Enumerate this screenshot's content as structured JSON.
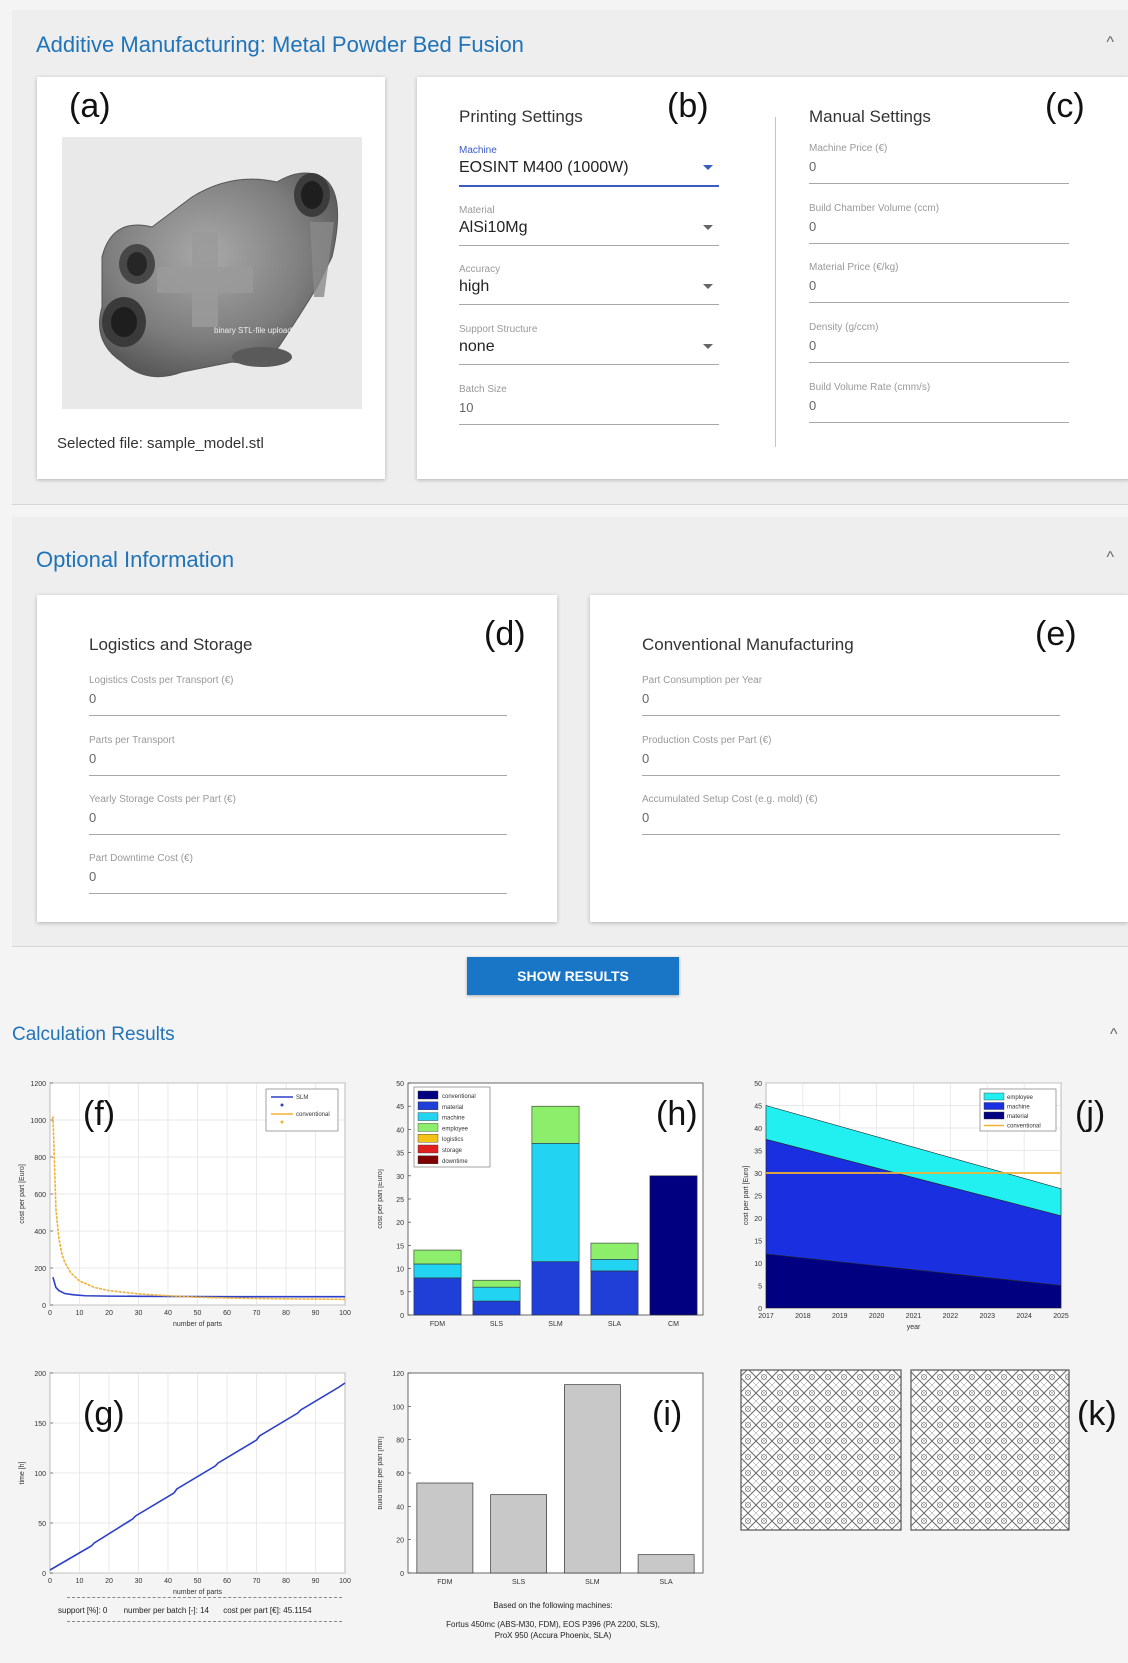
{
  "am_section": {
    "title": "Additive Manufacturing: Metal Powder Bed Fusion",
    "upload": {
      "letter": "(a)",
      "overlay_text": "binary STL-file upload",
      "selected_file": "Selected file: sample_model.stl"
    },
    "printing": {
      "letter": "(b)",
      "heading": "Printing Settings",
      "fields": [
        {
          "label": "Machine",
          "value": "EOSINT M400 (1000W)"
        },
        {
          "label": "Material",
          "value": "AlSi10Mg"
        },
        {
          "label": "Accuracy",
          "value": "high"
        },
        {
          "label": "Support Structure",
          "value": "none"
        },
        {
          "label": "Batch Size",
          "value": "10"
        }
      ]
    },
    "manual": {
      "letter": "(c)",
      "heading": "Manual Settings",
      "fields": [
        {
          "label": "Machine Price (€)",
          "value": "0"
        },
        {
          "label": "Build Chamber Volume (ccm)",
          "value": "0"
        },
        {
          "label": "Material Price (€/kg)",
          "value": "0"
        },
        {
          "label": "Density (g/ccm)",
          "value": "0"
        },
        {
          "label": "Build Volume Rate (cmm/s)",
          "value": "0"
        }
      ]
    }
  },
  "optional_section": {
    "title": "Optional Information",
    "logistics": {
      "letter": "(d)",
      "heading": "Logistics and Storage",
      "fields": [
        {
          "label": "Logistics Costs per Transport (€)",
          "value": "0"
        },
        {
          "label": "Parts per Transport",
          "value": "0"
        },
        {
          "label": "Yearly Storage Costs per Part (€)",
          "value": "0"
        },
        {
          "label": "Part Downtime Cost (€)",
          "value": "0"
        }
      ]
    },
    "conventional": {
      "letter": "(e)",
      "heading": "Conventional Manufacturing",
      "fields": [
        {
          "label": "Part Consumption per Year",
          "value": "0"
        },
        {
          "label": "Production Costs per Part (€)",
          "value": "0"
        },
        {
          "label": "Accumulated Setup Cost (e.g. mold) (€)",
          "value": "0"
        }
      ]
    }
  },
  "show_results_label": "SHOW RESULTS",
  "results_section": {
    "title": "Calculation Results",
    "letters": {
      "f": "(f)",
      "g": "(g)",
      "h": "(h)",
      "i": "(i)",
      "j": "(j)",
      "k": "(k)"
    },
    "f_summary": {
      "support": "support [%]: 0",
      "batch": "number per batch [-]: 14",
      "cost": "cost per part [€]: 45.1154"
    },
    "i_caption": [
      "Based on the following machines:",
      "Fortus 450mc (ABS-M30, FDM), EOS P396 (PA 2200, SLS),",
      "ProX 950 (Accura Phoenix, SLA)"
    ]
  },
  "colors": {
    "accent": "#1976c6",
    "title_blue": "#1f73b8",
    "slm_line": "#2b3fc9",
    "conventional_line": "#f2b233",
    "bar_gray": "#c8c8c8"
  },
  "chart_data": [
    {
      "id": "f",
      "type": "line",
      "xlabel": "number of parts",
      "ylabel": "cost per part [Euro]",
      "xlim": [
        0,
        100
      ],
      "ylim": [
        0,
        1200
      ],
      "xticks": [
        0,
        10,
        20,
        30,
        40,
        50,
        60,
        70,
        80,
        90,
        100
      ],
      "yticks": [
        0,
        200,
        400,
        600,
        800,
        1000,
        1200
      ],
      "legend": [
        "SLM",
        "conventional"
      ],
      "legend_position": "top-right",
      "grid": true,
      "series": [
        {
          "name": "SLM",
          "x": [
            1,
            2,
            3,
            5,
            8,
            12,
            20,
            30,
            40,
            50,
            60,
            70,
            80,
            90,
            100
          ],
          "y": [
            150,
            95,
            78,
            62,
            55,
            50,
            48,
            47,
            46,
            46,
            45,
            45,
            45,
            45,
            45
          ]
        },
        {
          "name": "conventional",
          "x": [
            1,
            2,
            3,
            4,
            5,
            7,
            10,
            15,
            20,
            30,
            40,
            50,
            60,
            70,
            80,
            90,
            100
          ],
          "y": [
            1020,
            520,
            360,
            280,
            230,
            175,
            130,
            95,
            78,
            60,
            50,
            42,
            38,
            35,
            33,
            32,
            30
          ]
        }
      ]
    },
    {
      "id": "g",
      "type": "line",
      "xlabel": "number of parts",
      "ylabel": "time [h]",
      "xlim": [
        0,
        100
      ],
      "ylim": [
        0,
        200
      ],
      "xticks": [
        0,
        10,
        20,
        30,
        40,
        50,
        60,
        70,
        80,
        90,
        100
      ],
      "yticks": [
        0,
        50,
        100,
        150,
        200
      ],
      "grid": true,
      "series": [
        {
          "name": "",
          "x": [
            0,
            14,
            15,
            28,
            29,
            42,
            43,
            56,
            57,
            70,
            71,
            84,
            85,
            98,
            100
          ],
          "y": [
            3,
            27,
            30,
            54,
            57,
            80,
            84,
            107,
            110,
            133,
            137,
            160,
            163,
            186,
            190
          ]
        }
      ]
    },
    {
      "id": "h",
      "type": "bar",
      "ylabel": "cost per part [Euro]",
      "ylim": [
        0,
        50
      ],
      "yticks": [
        0,
        5,
        10,
        15,
        20,
        25,
        30,
        35,
        40,
        45,
        50
      ],
      "categories": [
        "FDM",
        "SLS",
        "SLM",
        "SLA",
        "CM"
      ],
      "legend": [
        "conventional",
        "material",
        "machine",
        "employee",
        "logistics",
        "storage",
        "downtime"
      ],
      "legend_position": "top-left",
      "grid": false,
      "series": [
        {
          "name": "conventional",
          "color": "#000080",
          "values": [
            0,
            0,
            0,
            0,
            30
          ]
        },
        {
          "name": "material",
          "color": "#1f3fd6",
          "values": [
            8,
            3,
            11.5,
            9.5,
            0
          ]
        },
        {
          "name": "machine",
          "color": "#22d3f2",
          "values": [
            3,
            3,
            25.5,
            2.5,
            0
          ]
        },
        {
          "name": "employee",
          "color": "#8cee6a",
          "values": [
            3,
            1.5,
            8,
            3.5,
            0
          ]
        },
        {
          "name": "logistics",
          "color": "#f5c318",
          "values": [
            0,
            0,
            0,
            0,
            0
          ]
        },
        {
          "name": "storage",
          "color": "#e21f1f",
          "values": [
            0,
            0,
            0,
            0,
            0
          ]
        },
        {
          "name": "downtime",
          "color": "#800000",
          "values": [
            0,
            0,
            0,
            0,
            0
          ]
        }
      ]
    },
    {
      "id": "i",
      "type": "bar",
      "ylabel": "build time per part [min]",
      "ylim": [
        0,
        120
      ],
      "yticks": [
        0,
        20,
        40,
        60,
        80,
        100,
        120
      ],
      "categories": [
        "FDM",
        "SLS",
        "SLM",
        "SLA"
      ],
      "values": [
        54,
        47,
        113,
        11
      ],
      "grid": false
    },
    {
      "id": "j",
      "type": "area",
      "xlabel": "year",
      "ylabel": "cost per part [Euro]",
      "ylim": [
        0,
        50
      ],
      "yticks": [
        0,
        5,
        10,
        15,
        20,
        25,
        30,
        35,
        40,
        45,
        50
      ],
      "x": [
        2017,
        2025
      ],
      "xticks": [
        2017,
        2018,
        2019,
        2020,
        2021,
        2022,
        2023,
        2024,
        2025
      ],
      "legend": [
        "employee",
        "machine",
        "material",
        "conventional"
      ],
      "legend_position": "top-right",
      "grid": true,
      "series": [
        {
          "name": "material",
          "color": "#000080",
          "values": [
            12,
            5
          ]
        },
        {
          "name": "machine",
          "color": "#1a2fe0",
          "values": [
            25.5,
            15.5
          ]
        },
        {
          "name": "employee",
          "color": "#22f0f0",
          "values": [
            7.5,
            6
          ]
        },
        {
          "name": "conventional",
          "color": "#f2b233",
          "values": [
            30,
            30
          ]
        }
      ]
    }
  ]
}
